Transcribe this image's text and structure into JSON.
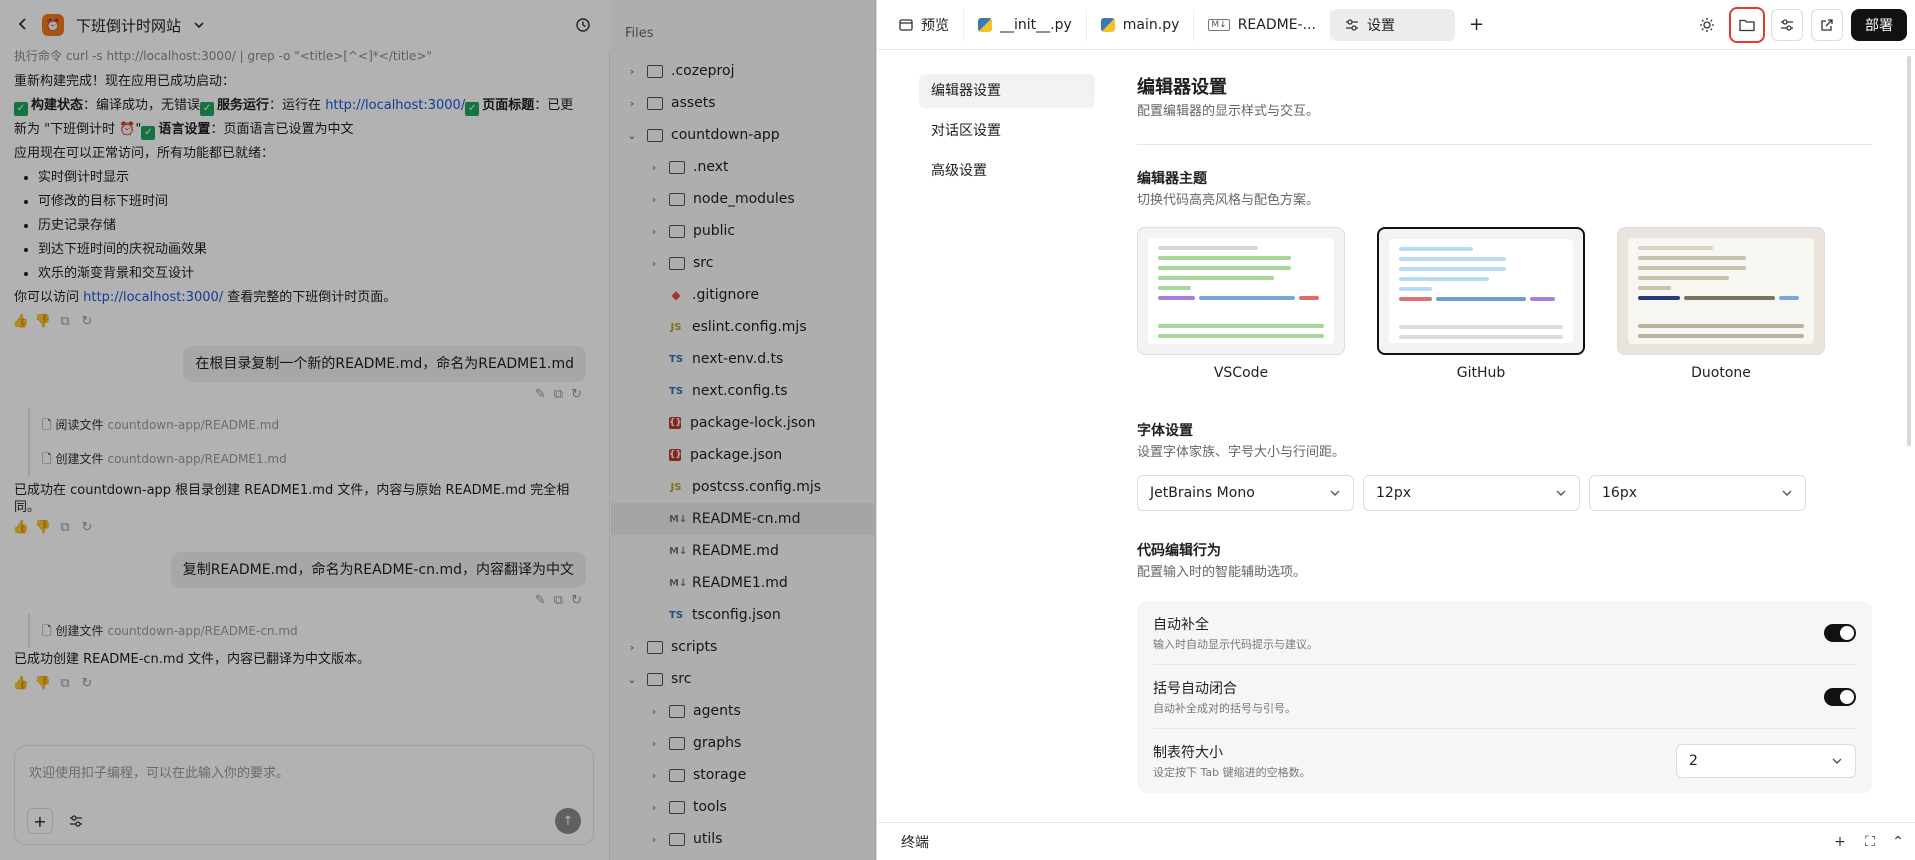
{
  "chat": {
    "title": "下班倒计时网站",
    "cmd_text": "执行命令 curl -s http://localhost:3000/ | grep -o \"<title>[^<]*</title>\"",
    "p1": "重新构建完成！现在应用已成功启动：",
    "l_build": "构建状态",
    "t_build": "：编译成功，无错误",
    "l_serve": "服务运行",
    "t_serve": "：运行在 ",
    "url": "http://localhost:3000/",
    "l_title": "页面标题",
    "t_title": "：已更新为 \"下班倒计时 ⏰\"",
    "l_lang": "语言设置",
    "t_lang": "：页面语言已设置为中文",
    "p2": "应用现在可以正常访问，所有功能都已就绪：",
    "bullets": [
      "实时倒计时显示",
      "可修改的目标下班时间",
      "历史记录存储",
      "到达下班时间的庆祝动画效果",
      "欢乐的渐变背景和交互设计"
    ],
    "visit_pre": "你可以访问 ",
    "visit_post": " 查看完整的下班倒计时页面。",
    "u1": "在根目录复制一个新的README.md，命名为README1.md",
    "tool_read": "阅读文件",
    "tool_read_path": "countdown-app/README.md",
    "tool_create": "创建文件",
    "tool_create_path": "countdown-app/README1.md",
    "a1": "已成功在 countdown-app 根目录创建 README1.md 文件，内容与原始 README.md 完全相同。",
    "u2": "复制README.md，命名为README-cn.md，内容翻译为中文",
    "tool_create2": "创建文件",
    "tool_create2_path": "countdown-app/README-cn.md",
    "a2": "已成功创建 README-cn.md 文件，内容已翻译为中文版本。",
    "input_placeholder": "欢迎使用扣子编程，可以在此输入你的要求。"
  },
  "files": {
    "header": "Files",
    "items": [
      {
        "name": ".cozeproj",
        "kind": "folder",
        "depth": 0,
        "open": false
      },
      {
        "name": "assets",
        "kind": "folder",
        "depth": 0,
        "open": false
      },
      {
        "name": "countdown-app",
        "kind": "folder",
        "depth": 0,
        "open": true
      },
      {
        "name": ".next",
        "kind": "folder",
        "depth": 1,
        "open": false
      },
      {
        "name": "node_modules",
        "kind": "folder",
        "depth": 1,
        "open": false
      },
      {
        "name": "public",
        "kind": "folder",
        "depth": 1,
        "open": false
      },
      {
        "name": "src",
        "kind": "folder",
        "depth": 1,
        "open": false
      },
      {
        "name": ".gitignore",
        "kind": "git",
        "depth": 1
      },
      {
        "name": "eslint.config.mjs",
        "kind": "js",
        "depth": 1
      },
      {
        "name": "next-env.d.ts",
        "kind": "ts",
        "depth": 1
      },
      {
        "name": "next.config.ts",
        "kind": "ts",
        "depth": 1
      },
      {
        "name": "package-lock.json",
        "kind": "json",
        "depth": 1
      },
      {
        "name": "package.json",
        "kind": "json",
        "depth": 1
      },
      {
        "name": "postcss.config.mjs",
        "kind": "js",
        "depth": 1
      },
      {
        "name": "README-cn.md",
        "kind": "md",
        "depth": 1,
        "selected": true
      },
      {
        "name": "README.md",
        "kind": "md",
        "depth": 1
      },
      {
        "name": "README1.md",
        "kind": "md",
        "depth": 1
      },
      {
        "name": "tsconfig.json",
        "kind": "ts",
        "depth": 1
      },
      {
        "name": "scripts",
        "kind": "folder",
        "depth": 0,
        "open": false
      },
      {
        "name": "src",
        "kind": "folder",
        "depth": 0,
        "open": true
      },
      {
        "name": "agents",
        "kind": "folder",
        "depth": 1,
        "open": false
      },
      {
        "name": "graphs",
        "kind": "folder",
        "depth": 1,
        "open": false
      },
      {
        "name": "storage",
        "kind": "folder",
        "depth": 1,
        "open": false
      },
      {
        "name": "tools",
        "kind": "folder",
        "depth": 1,
        "open": false
      },
      {
        "name": "utils",
        "kind": "folder",
        "depth": 1,
        "open": false
      }
    ]
  },
  "tabs": [
    {
      "label": "预览",
      "icon": "window-icon"
    },
    {
      "label": "__init__.py",
      "icon": "python-icon"
    },
    {
      "label": "main.py",
      "icon": "python-icon"
    },
    {
      "label": "README-...",
      "icon": "markdown-icon"
    },
    {
      "label": "设置",
      "icon": "sliders-icon"
    }
  ],
  "deploy_label": "部署",
  "settings": {
    "nav": [
      "编辑器设置",
      "对话区设置",
      "高级设置"
    ],
    "title": "编辑器设置",
    "subtitle": "配置编辑器的显示样式与交互。",
    "theme_title": "编辑器主题",
    "theme_sub": "切换代码高亮风格与配色方案。",
    "themes": [
      {
        "name": "VSCode",
        "selected": false
      },
      {
        "name": "GitHub",
        "selected": true
      },
      {
        "name": "Duotone",
        "selected": false
      }
    ],
    "font_title": "字体设置",
    "font_sub": "设置字体家族、字号大小与行间距。",
    "font_family": "JetBrains Mono",
    "font_size": "12px",
    "line_height": "16px",
    "behavior_title": "代码编辑行为",
    "behavior_sub": "配置输入时的智能辅助选项。",
    "autocomplete_title": "自动补全",
    "autocomplete_desc": "输入时自动显示代码提示与建议。",
    "autocomplete_on": true,
    "bracket_title": "括号自动闭合",
    "bracket_desc": "自动补全成对的括号与引号。",
    "bracket_on": true,
    "tab_title": "制表符大小",
    "tab_desc": "设定按下 Tab 键缩进的空格数。",
    "tab_value": "2"
  },
  "terminal_label": "终端",
  "colors": {
    "accent": "#111111",
    "highlight": "#e53935",
    "link": "#1a56db",
    "check": "#22a45d"
  }
}
